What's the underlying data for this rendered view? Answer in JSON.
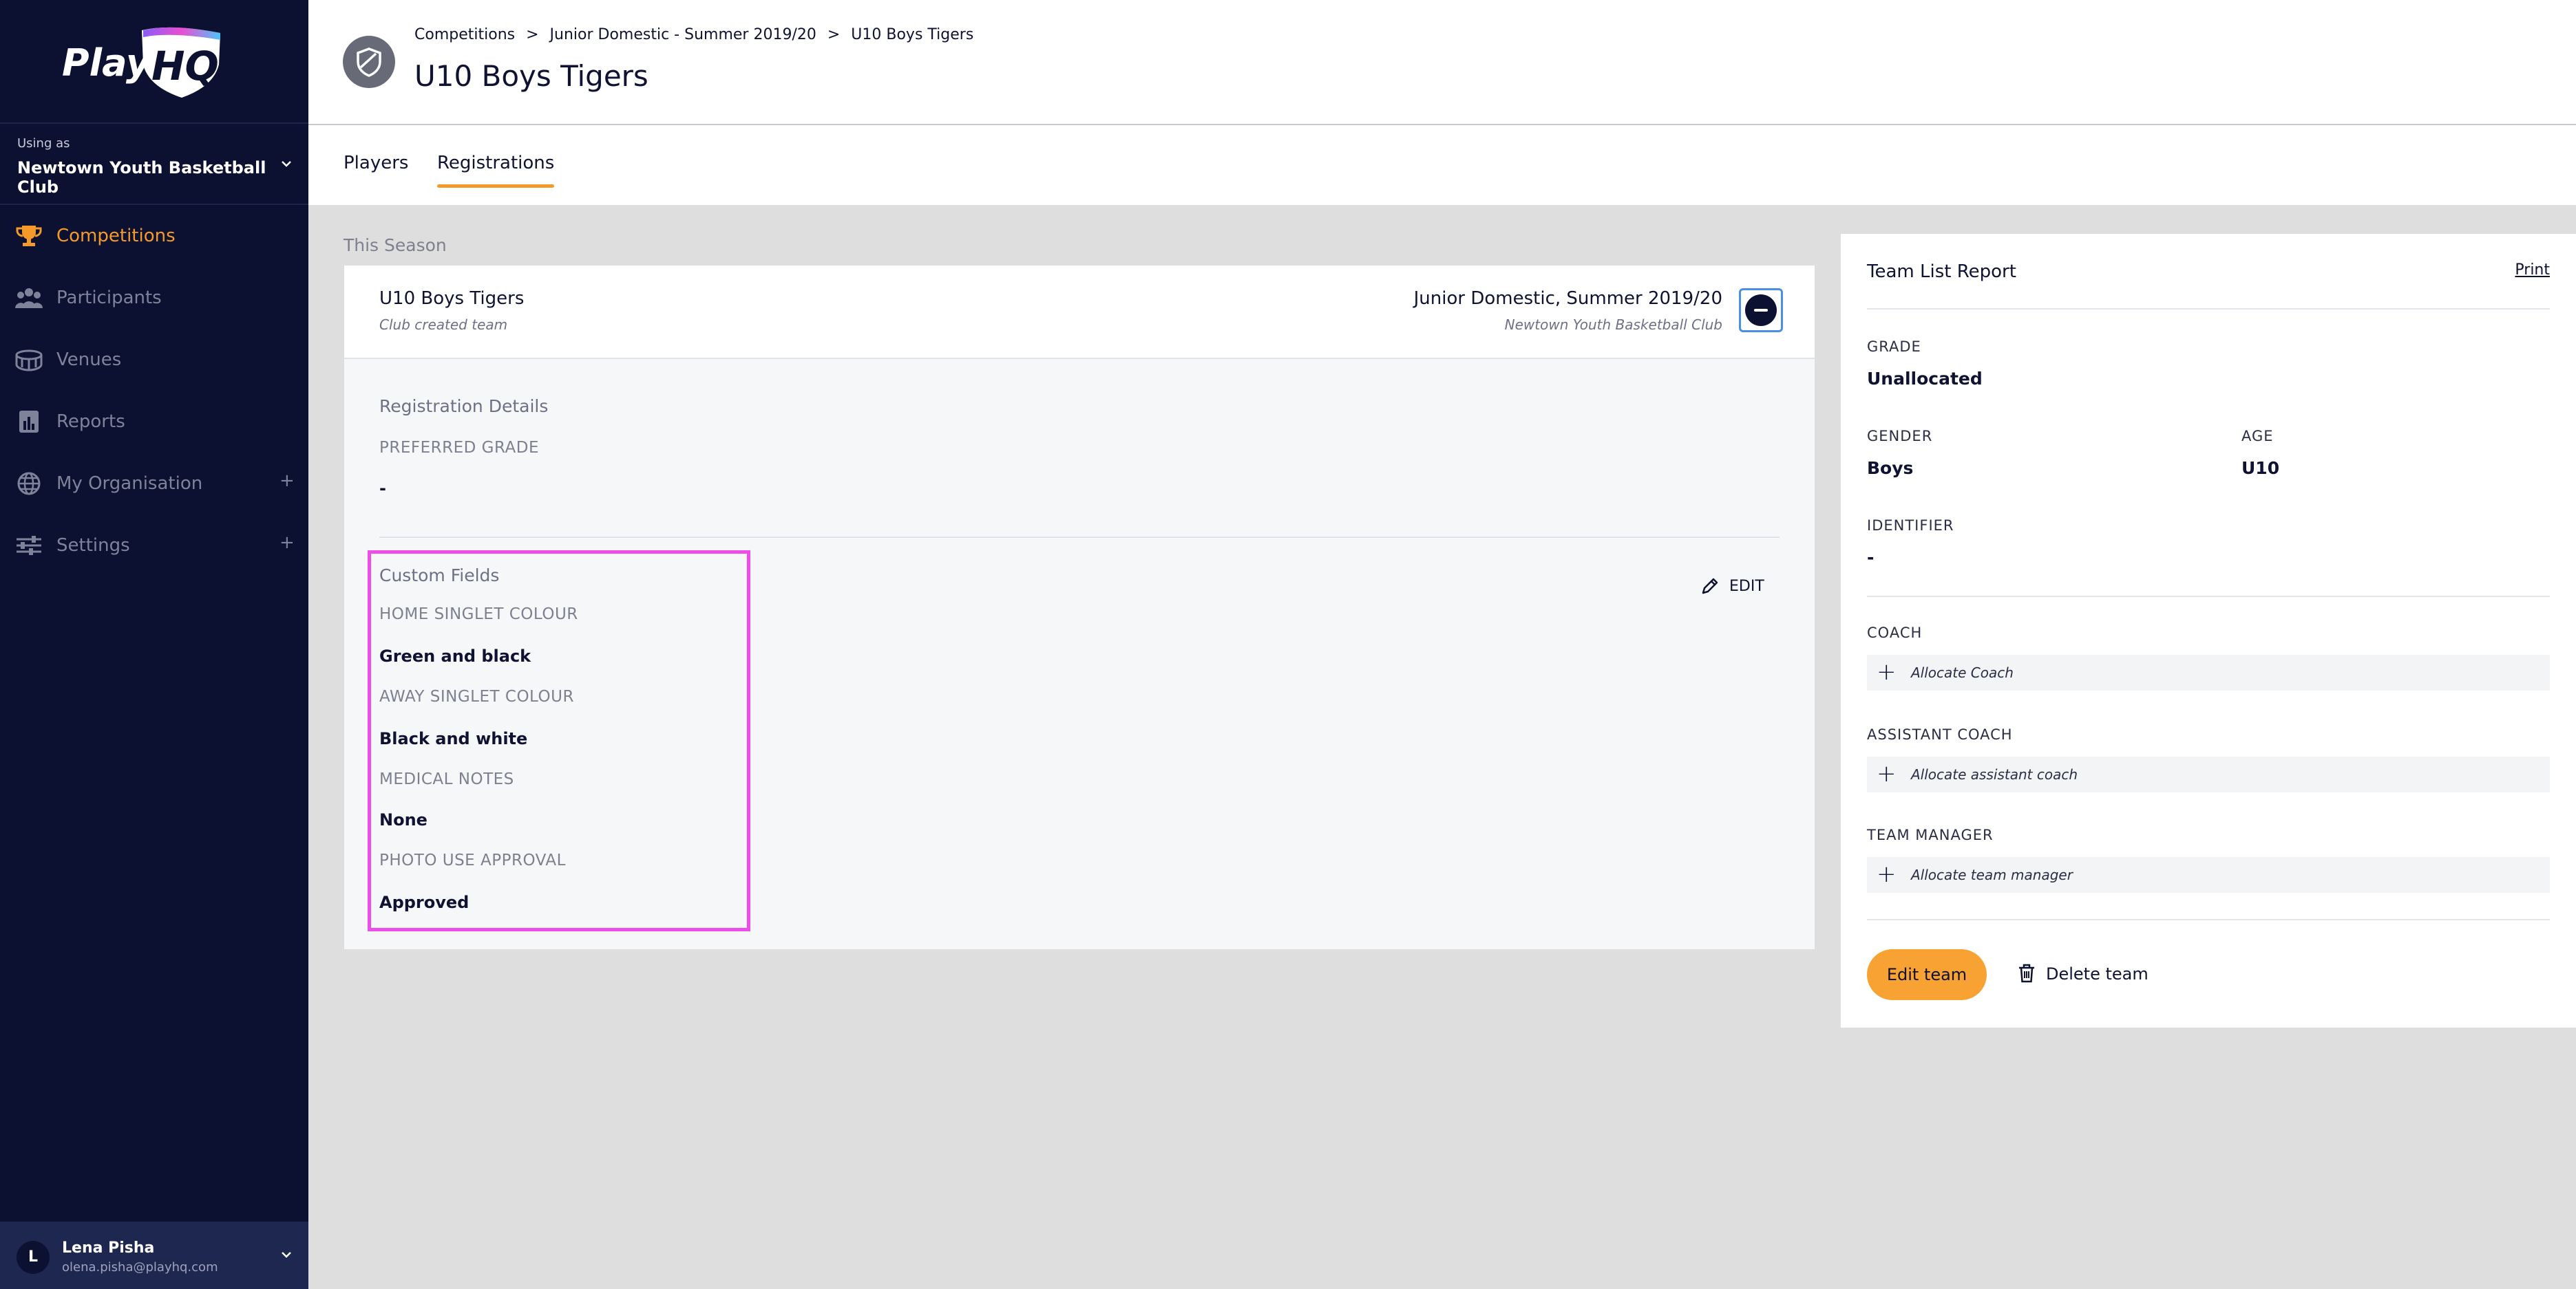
{
  "brand": {
    "logo_text": "PlayHQ",
    "accent": "#f39a2b",
    "sidebar_bg": "#0d1131"
  },
  "sidebar": {
    "using_as_label": "Using as",
    "organisation": "Newtown Youth Basketball Club",
    "items": [
      {
        "label": "Competitions",
        "icon": "trophy-icon",
        "active": true
      },
      {
        "label": "Participants",
        "icon": "people-icon"
      },
      {
        "label": "Venues",
        "icon": "stadium-icon"
      },
      {
        "label": "Reports",
        "icon": "report-icon"
      },
      {
        "label": "My Organisation",
        "icon": "globe-icon",
        "expandable": "+"
      },
      {
        "label": "Settings",
        "icon": "sliders-icon",
        "expandable": "+"
      }
    ],
    "user": {
      "initial": "L",
      "name": "Lena Pisha",
      "email": "olena.pisha@playhq.com"
    }
  },
  "header": {
    "breadcrumb": [
      "Competitions",
      "Junior Domestic - Summer 2019/20",
      "U10 Boys Tigers"
    ],
    "breadcrumb_sep": ">",
    "title": "U10 Boys Tigers",
    "tabs": [
      {
        "label": "Players"
      },
      {
        "label": "Registrations",
        "active": true
      }
    ]
  },
  "main": {
    "season_label": "This Season",
    "team": {
      "name": "U10 Boys Tigers",
      "subtitle": "Club created team",
      "competition": "Junior Domestic, Summer 2019/20",
      "club": "Newtown Youth Basketball Club"
    },
    "registration": {
      "title": "Registration Details",
      "preferred_grade_label": "PREFERRED GRADE",
      "preferred_grade_value": "-"
    },
    "custom_fields": {
      "title": "Custom Fields",
      "edit_label": "EDIT",
      "fields": [
        {
          "label": "HOME SINGLET COLOUR",
          "value": "Green and black"
        },
        {
          "label": "AWAY SINGLET COLOUR",
          "value": "Black and white"
        },
        {
          "label": "MEDICAL NOTES",
          "value": "None"
        },
        {
          "label": "PHOTO USE APPROVAL",
          "value": "Approved"
        }
      ]
    }
  },
  "panel": {
    "title": "Team List Report",
    "print_label": "Print",
    "grade_label": "GRADE",
    "grade_value": "Unallocated",
    "gender_label": "GENDER",
    "gender_value": "Boys",
    "age_label": "AGE",
    "age_value": "U10",
    "identifier_label": "IDENTIFIER",
    "identifier_value": "-",
    "coach_label": "COACH",
    "coach_action": "Allocate Coach",
    "assistant_label": "ASSISTANT COACH",
    "assistant_action": "Allocate assistant coach",
    "manager_label": "TEAM MANAGER",
    "manager_action": "Allocate team manager",
    "edit_team_label": "Edit team",
    "delete_team_label": "Delete team"
  }
}
